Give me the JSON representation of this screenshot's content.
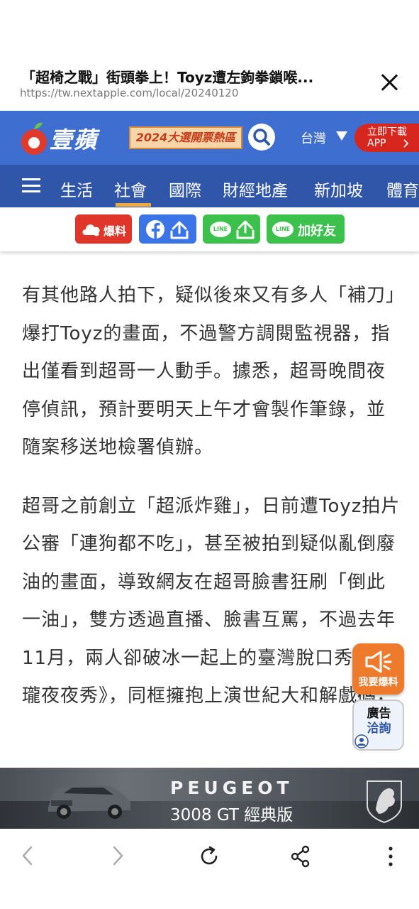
{
  "browser": {
    "page_title": "「超椅之戰」街頭拳上！Toyz遭左鉤拳鎖喉...",
    "url": "https://tw.nextapple.com/local/20240120"
  },
  "site": {
    "logo_text": "壹蘋",
    "promo_text": "2024大選開票熱區",
    "region": "台灣",
    "app_button": [
      "立即下載",
      "APP"
    ],
    "brand_color": "#3e6fd0"
  },
  "nav": {
    "items": [
      "生活",
      "社會",
      "國際",
      "財經地產",
      "新加坡",
      "體育"
    ],
    "active": "社會"
  },
  "share": {
    "baoliao": "爆料",
    "line_text": "LINE",
    "add_friend": "加好友"
  },
  "article": {
    "paragraphs": [
      "有其他路人拍下，疑似後來又有多人「補刀」爆打Toyz的畫面，不過警方調閱監視器，指出僅看到超哥一人動手。據悉，超哥晚間夜停偵訊，預計要明天上午才會製作筆錄，並隨案移送地檢署偵辦。",
      "超哥之前創立「超派炸雞」，日前遭Toyz拍片公審「連狗都不吃」，甚至被拍到疑似亂倒廢油的畫面，導致網友在超哥臉書狂刷「倒此一油」，雙方透過直播、臉書互罵，不過去年11月，兩人卻破冰一起上的臺灣脫口秀《賀瓏夜夜秀》，同框擁抱上演世紀大和解戲碼，"
    ]
  },
  "floating": {
    "report": "我要爆料",
    "ad_inquiry": [
      "廣告",
      "洽詢"
    ]
  },
  "ad": {
    "brand": "PEUGEOT",
    "model": "3008 GT 經典版"
  }
}
